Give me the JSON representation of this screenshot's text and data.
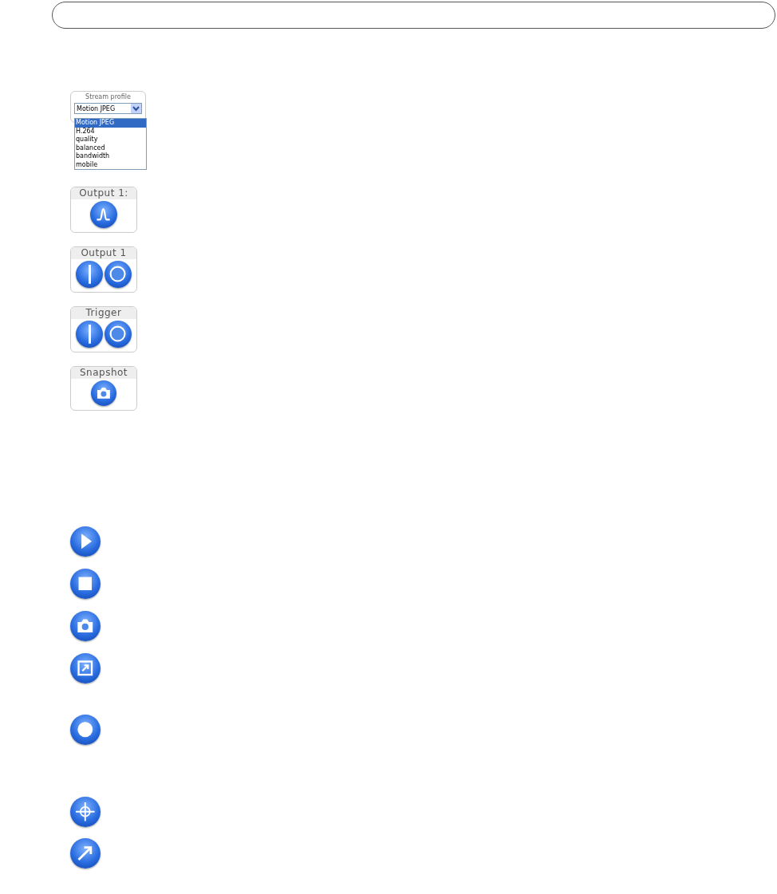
{
  "stream_profile": {
    "label": "Stream profile",
    "value": "Motion JPEG",
    "options": [
      {
        "label": "Motion JPEG",
        "selected": true
      },
      {
        "label": "H.264",
        "selected": false
      },
      {
        "label": "quality",
        "selected": false
      },
      {
        "label": "balanced",
        "selected": false
      },
      {
        "label": "bandwidth",
        "selected": false
      },
      {
        "label": "mobile",
        "selected": false
      }
    ]
  },
  "widgets": [
    {
      "kind": "pulse",
      "title": "Output 1:"
    },
    {
      "kind": "toggle",
      "title": "Output 1"
    },
    {
      "kind": "toggle",
      "title": "Trigger"
    },
    {
      "kind": "snapshot",
      "title": "Snapshot"
    }
  ],
  "icons": [
    {
      "kind": "play"
    },
    {
      "kind": "stop"
    },
    {
      "kind": "snapshot"
    },
    {
      "kind": "view"
    },
    {
      "kind": "record"
    },
    {
      "kind": "center"
    },
    {
      "kind": "arrow"
    }
  ]
}
